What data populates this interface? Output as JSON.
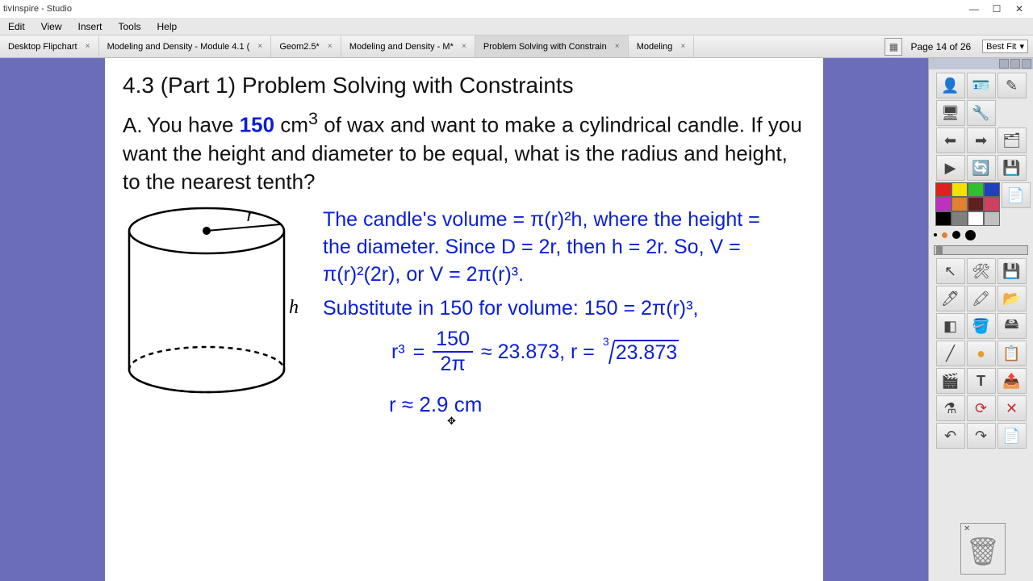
{
  "app": {
    "title": "tivInspire - Studio"
  },
  "menu": {
    "edit": "Edit",
    "view": "View",
    "insert": "Insert",
    "tools": "Tools",
    "help": "Help"
  },
  "tabs": [
    {
      "label": "Desktop Flipchart"
    },
    {
      "label": "Modeling and Density - Module 4.1 ("
    },
    {
      "label": "Geom2.5*"
    },
    {
      "label": "Modeling and Density - M*"
    },
    {
      "label": "Problem Solving with Constrain",
      "active": true
    },
    {
      "label": "Modeling"
    }
  ],
  "page_indicator": {
    "label": "Page 14 of 26"
  },
  "zoom": {
    "value": "Best Fit"
  },
  "content": {
    "title": "4.3 (Part 1) Problem Solving with Constraints",
    "problem_letter": "A.",
    "problem_pre": "You have ",
    "problem_num": "150",
    "problem_post1": " cm",
    "problem_exp": "3",
    "problem_post2": " of wax and want to make a cylindrical candle. If you want the height and diameter to be equal, what is the radius and height, to the nearest tenth?",
    "sol_line1": "The candle's volume = π(r)²h, where the height = the diameter. Since D = 2r, then h = 2r. So, V = π(r)²(2r), or V = 2π(r)³.",
    "sol_line2": "Substitute in 150 for volume:  150 = 2π(r)³,",
    "eq_r3": "r³",
    "eq_eq": "=",
    "eq_top": "150",
    "eq_bot": "2π",
    "eq_approx": "≈  23.873,  r  =",
    "eq_root_idx": "3",
    "eq_root_val": "23.873",
    "answer": "r  ≈  2.9 cm",
    "h_label": "h",
    "r_label": "r"
  },
  "palette": {
    "colors": [
      "#e02020",
      "#f5e000",
      "#30c030",
      "#2040c0",
      "#c030c0",
      "#e08030",
      "#602020",
      "#d04060",
      "#000000",
      "#808080",
      "#ffffff",
      "#c0c0c0"
    ]
  },
  "trash": {
    "label": "Trash"
  }
}
